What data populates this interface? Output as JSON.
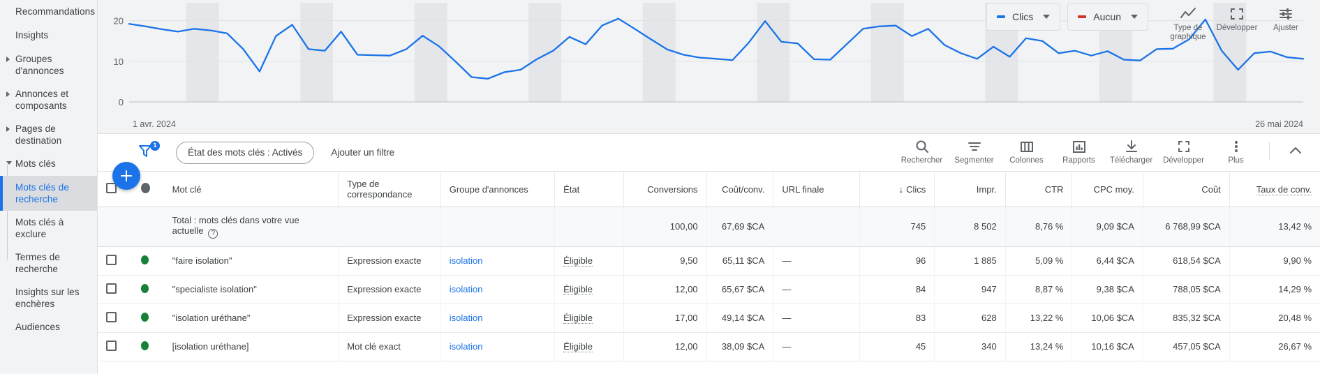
{
  "sidebar": {
    "items": [
      {
        "label": "Recommandations",
        "caret": "none",
        "selected": false
      },
      {
        "label": "Insights",
        "caret": "none",
        "selected": false
      },
      {
        "label": "Groupes d'annonces",
        "caret": "right",
        "selected": false
      },
      {
        "label": "Annonces et composants",
        "caret": "right",
        "selected": false
      },
      {
        "label": "Pages de destination",
        "caret": "right",
        "selected": false
      },
      {
        "label": "Mots clés",
        "caret": "down",
        "selected": false
      },
      {
        "label": "Mots clés de recherche",
        "caret": "none",
        "selected": true
      },
      {
        "label": "Mots clés à exclure",
        "caret": "none",
        "selected": false
      },
      {
        "label": "Termes de recherche",
        "caret": "none",
        "selected": false
      },
      {
        "label": "Insights sur les enchères",
        "caret": "none",
        "selected": false
      },
      {
        "label": "Audiences",
        "caret": "none",
        "selected": false
      }
    ]
  },
  "chart": {
    "metric_primary": {
      "label": "Clics",
      "color": "#1a73e8"
    },
    "metric_secondary": {
      "label": "Aucun",
      "color": "#d93025"
    },
    "tools": [
      {
        "label": "Type de graphique",
        "icon": "line-chart-icon"
      },
      {
        "label": "Développer",
        "icon": "expand-icon"
      },
      {
        "label": "Ajuster",
        "icon": "tune-icon"
      }
    ],
    "date_start": "1 avr. 2024",
    "date_end": "26 mai 2024"
  },
  "chart_data": {
    "type": "line",
    "title": "",
    "xlabel": "",
    "ylabel": "Clics",
    "ylim": [
      0,
      22
    ],
    "yticks": [
      0,
      10,
      20
    ],
    "ytick_labels": [
      "0",
      "10",
      "20"
    ],
    "x_start": "1 avr. 2024",
    "x_end": "26 mai 2024",
    "grid": true,
    "legend": [
      "Clics"
    ],
    "series": [
      {
        "name": "Clics",
        "color": "#1a73e8",
        "values": [
          19.2,
          18.6,
          17.9,
          17.3,
          18.0,
          17.6,
          16.9,
          13.0,
          7.5,
          16.2,
          19.0,
          13.0,
          12.6,
          17.3,
          11.6,
          11.5,
          11.4,
          13.0,
          16.3,
          13.7,
          10.0,
          6.1,
          5.7,
          7.3,
          7.9,
          10.5,
          12.6,
          16.0,
          14.2,
          18.8,
          20.5,
          18.0,
          15.4,
          12.9,
          11.6,
          10.9,
          10.6,
          10.3,
          14.6,
          19.9,
          14.8,
          14.4,
          10.5,
          10.4,
          14.2,
          18.0,
          18.6,
          18.8,
          16.2,
          18.0,
          14.0,
          12.0,
          10.6,
          13.6,
          11.1,
          15.7,
          15.0,
          12.0,
          12.6,
          11.4,
          12.5,
          10.4,
          10.2,
          13.0,
          13.1,
          15.4,
          20.3,
          12.6,
          7.9,
          12.0,
          12.4,
          11.0,
          10.6
        ]
      }
    ],
    "weekend_bands": true
  },
  "filters": {
    "badge_count": "1",
    "chip_label": "État des mots clés : Activés",
    "add_filter_label": "Ajouter un filtre"
  },
  "toolbar": [
    {
      "label": "Rechercher",
      "icon": "search-icon"
    },
    {
      "label": "Segmenter",
      "icon": "segment-icon"
    },
    {
      "label": "Colonnes",
      "icon": "columns-icon"
    },
    {
      "label": "Rapports",
      "icon": "reports-icon"
    },
    {
      "label": "Télécharger",
      "icon": "download-icon"
    },
    {
      "label": "Développer",
      "icon": "expand-icon"
    },
    {
      "label": "Plus",
      "icon": "more-vertical-icon"
    }
  ],
  "table": {
    "headers": {
      "keyword": "Mot clé",
      "match_type": "Type de correspondance",
      "ad_group": "Groupe d'annonces",
      "status": "État",
      "conversions": "Conversions",
      "cost_conv": "Coût/conv.",
      "final_url": "URL finale",
      "clicks": "Clics",
      "impressions": "Impr.",
      "ctr": "CTR",
      "avg_cpc": "CPC moy.",
      "cost": "Coût",
      "conv_rate": "Taux de conv."
    },
    "sorted_column": "Clics",
    "sort_direction": "desc",
    "totals": {
      "label": "Total : mots clés dans votre vue actuelle",
      "conversions": "100,00",
      "cost_conv": "67,69 $CA",
      "final_url": "",
      "clicks": "745",
      "impressions": "8 502",
      "ctr": "8,76 %",
      "avg_cpc": "9,09 $CA",
      "cost": "6 768,99 $CA",
      "conv_rate": "13,42 %"
    },
    "rows": [
      {
        "keyword": "\"faire isolation\"",
        "match_type": "Expression exacte",
        "ad_group": "isolation",
        "status": "Éligible",
        "conversions": "9,50",
        "cost_conv": "65,11 $CA",
        "final_url": "—",
        "clicks": "96",
        "impressions": "1 885",
        "ctr": "5,09 %",
        "avg_cpc": "6,44 $CA",
        "cost": "618,54 $CA",
        "conv_rate": "9,90 %"
      },
      {
        "keyword": "\"specialiste isolation\"",
        "match_type": "Expression exacte",
        "ad_group": "isolation",
        "status": "Éligible",
        "conversions": "12,00",
        "cost_conv": "65,67 $CA",
        "final_url": "—",
        "clicks": "84",
        "impressions": "947",
        "ctr": "8,87 %",
        "avg_cpc": "9,38 $CA",
        "cost": "788,05 $CA",
        "conv_rate": "14,29 %"
      },
      {
        "keyword": "\"isolation uréthane\"",
        "match_type": "Expression exacte",
        "ad_group": "isolation",
        "status": "Éligible",
        "conversions": "17,00",
        "cost_conv": "49,14 $CA",
        "final_url": "—",
        "clicks": "83",
        "impressions": "628",
        "ctr": "13,22 %",
        "avg_cpc": "10,06 $CA",
        "cost": "835,32 $CA",
        "conv_rate": "20,48 %"
      },
      {
        "keyword": "[isolation uréthane]",
        "match_type": "Mot clé exact",
        "ad_group": "isolation",
        "status": "Éligible",
        "conversions": "12,00",
        "cost_conv": "38,09 $CA",
        "final_url": "—",
        "clicks": "45",
        "impressions": "340",
        "ctr": "13,24 %",
        "avg_cpc": "10,16 $CA",
        "cost": "457,05 $CA",
        "conv_rate": "26,67 %"
      }
    ]
  }
}
